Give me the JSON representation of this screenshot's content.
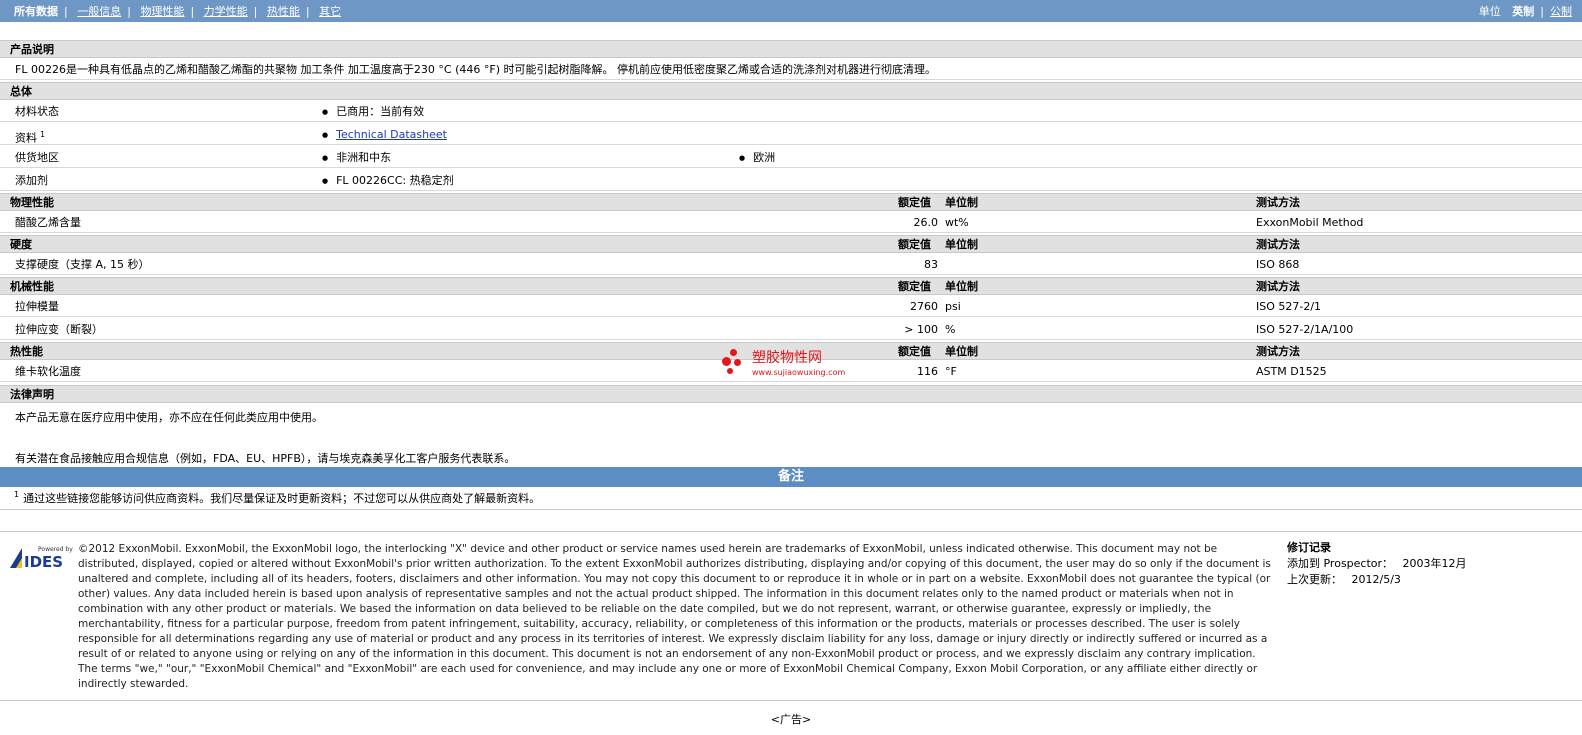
{
  "nav": {
    "all": "所有数据",
    "items": [
      "一般信息",
      "物理性能",
      "力学性能",
      "热性能",
      "其它"
    ],
    "units_label": "单位",
    "unit_english": "英制",
    "unit_metric": "公制"
  },
  "product_desc": {
    "title": "产品说明",
    "text": "FL 00226是一种具有低晶点的乙烯和醋酸乙烯酯的共聚物 加工条件 加工温度高于230 °C (446 °F) 时可能引起树脂降解。 停机前应使用低密度聚乙烯或合适的洗涤剂对机器进行彻底清理。"
  },
  "general": {
    "title": "总体",
    "rows": [
      {
        "label": "材料状态",
        "values": [
          "已商用：当前有效"
        ]
      },
      {
        "label": "资料",
        "sup": "1",
        "values": [
          "Technical Datasheet"
        ]
      },
      {
        "label": "供货地区",
        "values": [
          "非洲和中东",
          "欧洲"
        ]
      },
      {
        "label": "添加剂",
        "values": [
          "FL 00226CC: 热稳定剂"
        ]
      }
    ]
  },
  "col_headers": {
    "nominal": "额定值",
    "unit": "单位制",
    "method": "测试方法"
  },
  "physical": {
    "title": "物理性能",
    "rows": [
      {
        "label": "醋酸乙烯含量",
        "value": "26.0",
        "unit": "wt%",
        "method": "ExxonMobil Method"
      }
    ]
  },
  "hardness": {
    "title": "硬度",
    "rows": [
      {
        "label": "支撑硬度（支撑 A, 15 秒）",
        "value": "83",
        "unit": "",
        "method": "ISO 868"
      }
    ]
  },
  "mechanical": {
    "title": "机械性能",
    "rows": [
      {
        "label": "拉伸模量",
        "value": "2760",
        "unit": "psi",
        "method": "ISO 527-2/1"
      },
      {
        "label": "拉伸应变（断裂）",
        "value": "> 100",
        "unit": "%",
        "method": "ISO 527-2/1A/100"
      }
    ]
  },
  "thermal": {
    "title": "热性能",
    "rows": [
      {
        "label": "维卡软化温度",
        "value": "116",
        "unit": "°F",
        "method": "ASTM D1525"
      }
    ]
  },
  "legal": {
    "title": "法律声明",
    "line1": "本产品无意在医疗应用中使用，亦不应在任何此类应用中使用。",
    "line2": "有关潜在食品接触应用合规信息（例如，FDA、EU、HPFB），请与埃克森美孚化工客户服务代表联系。"
  },
  "notes": {
    "title": "备注",
    "sup": "1",
    "text": "通过这些链接您能够访问供应商资料。我们尽量保证及时更新资料；不过您可以从供应商处了解最新资料。"
  },
  "watermark": {
    "name": "塑胶物性网",
    "url": "www.sujiaowuxing.com"
  },
  "logo": {
    "powered": "Powered by",
    "name": "IDES"
  },
  "copyright": "©2012 ExxonMobil. ExxonMobil, the ExxonMobil logo, the interlocking \"X\" device and other product or service names used herein are trademarks of ExxonMobil, unless indicated otherwise. This document may not be distributed, displayed, copied or altered without ExxonMobil's prior written authorization. To the extent ExxonMobil authorizes distributing, displaying and/or copying of this document, the user may do so only if the document is unaltered and complete, including all of its headers, footers, disclaimers and other information. You may not copy this document to or reproduce it in whole or in part on a website. ExxonMobil does not guarantee the typical (or other) values. Any data included herein is based upon analysis of representative samples and not the actual product shipped. The information in this document relates only to the named product or materials when not in combination with any other product or materials. We based the information on data believed to be reliable on the date compiled, but we do not represent, warrant, or otherwise guarantee, expressly or impliedly, the merchantability, fitness for a particular purpose, freedom from patent infringement, suitability, accuracy, reliability, or completeness of this information or the products, materials or processes described. The user is solely responsible for all determinations regarding any use of material or product and any process in its territories of interest. We expressly disclaim liability for any loss, damage or injury directly or indirectly suffered or incurred as a result of or related to anyone using or relying on any of the information in this document. This document is not an endorsement of any non-ExxonMobil product or process, and we expressly disclaim any contrary implication. The terms \"we,\" \"our,\" \"ExxonMobil Chemical\" and \"ExxonMobil\" are each used for convenience, and may include any one or more of ExxonMobil Chemical Company, Exxon Mobil Corporation, or any affiliate either directly or indirectly stewarded.",
  "revision": {
    "title": "修订记录",
    "added_label": "添加到 Prospector：",
    "added_value": "2003年12月",
    "updated_label": "上次更新：",
    "updated_value": "2012/5/3"
  },
  "ad": "<广告>"
}
